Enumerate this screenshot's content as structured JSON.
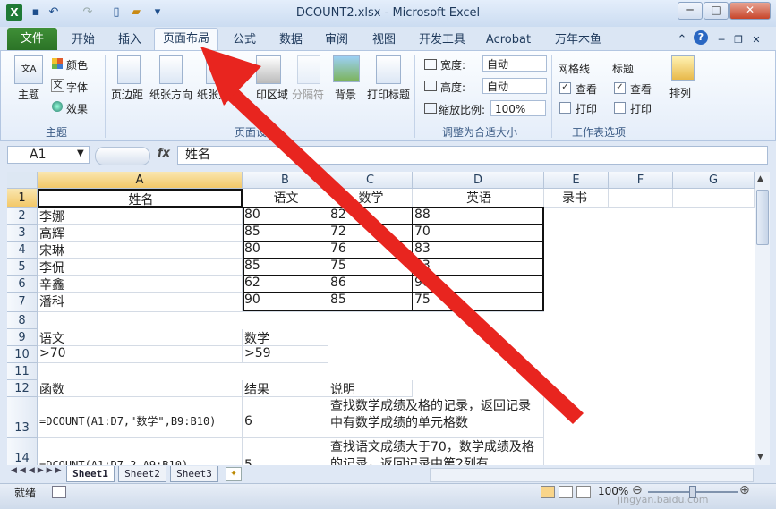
{
  "window": {
    "title": "DCOUNT2.xlsx - Microsoft Excel",
    "minimize": "─",
    "maximize": "□",
    "close": "✕"
  },
  "tabs": [
    "文件",
    "开始",
    "插入",
    "页面布局",
    "公式",
    "数据",
    "审阅",
    "视图",
    "开发工具",
    "Acrobat",
    "万年木鱼"
  ],
  "active_tab": "页面布局",
  "ribbon": {
    "theme_group": {
      "label": "主题",
      "theme_button": "主题",
      "colors": "颜色",
      "fonts": "字体",
      "effects": "效果"
    },
    "page_setup_group": {
      "label": "页面设置",
      "margins": "页边距",
      "orientation": "纸张方向",
      "size": "纸张大",
      "print_area": "印区域",
      "breaks": "分隔符",
      "background": "背景",
      "print_titles": "打印标题"
    },
    "scale_group": {
      "label": "调整为合适大小",
      "width_label": "宽度:",
      "width_value": "自动",
      "height_label": "高度:",
      "height_value": "自动",
      "scale_label": "缩放比例:",
      "scale_value": "100%"
    },
    "sheet_options_group": {
      "label": "工作表选项",
      "gridlines": "网格线",
      "headings": "标题",
      "view1": "查看",
      "print1": "打印",
      "view2": "查看",
      "print2": "打印"
    },
    "arrange_group": {
      "arrange": "排列"
    }
  },
  "formula_bar": {
    "name_box": "A1",
    "fx": "fx",
    "content": "姓名"
  },
  "columns": [
    "A",
    "B",
    "C",
    "D",
    "E",
    "F",
    "G"
  ],
  "rows": [
    "1",
    "2",
    "3",
    "4",
    "5",
    "6",
    "7",
    "8",
    "9",
    "10",
    "11",
    "12",
    "13",
    "14"
  ],
  "cells": {
    "header": [
      "姓名",
      "语文",
      "数学",
      "英语",
      "录书"
    ],
    "students": [
      [
        "李娜",
        "80",
        "82",
        "88"
      ],
      [
        "高辉",
        "85",
        "72",
        "70"
      ],
      [
        "宋琳",
        "80",
        "76",
        "83"
      ],
      [
        "李侃",
        "85",
        "75",
        "83"
      ],
      [
        "辛鑫",
        "62",
        "86",
        "90"
      ],
      [
        "潘科",
        "90",
        "85",
        "75"
      ]
    ],
    "r9": [
      "语文",
      "数学"
    ],
    "r10": [
      ">70",
      ">59"
    ],
    "r12": [
      "函数",
      "结果",
      "说明"
    ],
    "r13": [
      "=DCOUNT(A1:D7,\"数学\",B9:B10)",
      "6",
      "查找数学成绩及格的记录，返回记录中有数学成绩的单元格数"
    ],
    "r14": [
      "=DCOUNT(A1:D7,2,A9:B10)",
      "5",
      "查找语文成绩大于70，数学成绩及格的记录，返回记录中第2列有"
    ]
  },
  "sheets": [
    "Sheet1",
    "Sheet2",
    "Sheet3"
  ],
  "status": {
    "ready": "就绪",
    "zoom": "100%",
    "watermark": "jingyan.baidu.com"
  }
}
